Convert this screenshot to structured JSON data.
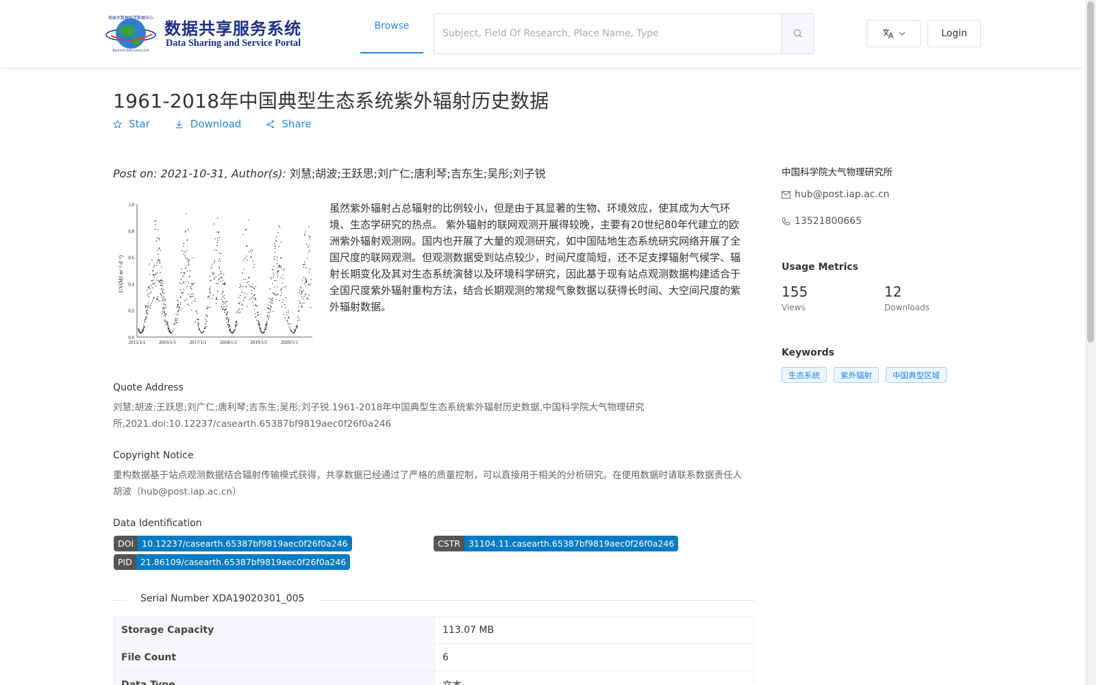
{
  "header": {
    "logo_cn": "数据共享服务系统",
    "logo_en": "Data Sharing and Service Portal",
    "nav_browse": "Browse",
    "search_placeholder": "Subject, Field Of Research, Place Name, Type",
    "login": "Login"
  },
  "dataset": {
    "title": "1961-2018年中国典型生态系统紫外辐射历史数据",
    "actions": {
      "star": "Star",
      "download": "Download",
      "share": "Share"
    },
    "post_prefix": "Post on: 2021-10-31, Author(s):",
    "authors": "刘慧;胡波;王跃思;刘广仁;唐利琴;吉东生;吴彤;刘子锐",
    "abstract": "虽然紫外辐射占总辐射的比例较小，但是由于其显著的生物、环境效应，使其成为大气环境、生态学研究的热点。 紫外辐射的联网观测开展得较晚，主要有20世纪80年代建立的欧洲紫外辐射观测网。国内也开展了大量的观测研究，如中国陆地生态系统研究网络开展了全国尺度的联网观测。但观测数据受到站点较少，时间尺度简短，还不足支撑辐射气候学、辐射长期变化及其对生态系统演替以及环境科学研究，因此基于现有站点观测数据构建适合于全国尺度紫外辐射重构方法，结合长期观测的常规气象数据以获得长时间、大空间尺度的紫外辐射数据。"
  },
  "figure": {
    "ylabel": "UV(MJ m⁻² d⁻¹)",
    "yticks": [
      "1.0",
      "0.8",
      "0.6",
      "0.4",
      "0.2",
      "0.0"
    ],
    "xticks": [
      "2015/1/1",
      "2016/1/1",
      "2017/1/1",
      "2018/1/1",
      "2019/1/1",
      "2020/1/1"
    ]
  },
  "quote": {
    "heading": "Quote Address",
    "text": "刘慧;胡波;王跃思;刘广仁;唐利琴;吉东生;吴彤;刘子锐.1961-2018年中国典型生态系统紫外辐射历史数据,中国科学院大气物理研究所,2021.doi:10.12237/casearth.65387bf9819aec0f26f0a246"
  },
  "copyright": {
    "heading": "Copyright Notice",
    "text": "重构数据基于站点观测数据结合辐射传输模式获得，共享数据已经通过了严格的质量控制，可以直接用于相关的分析研究。在使用数据时请联系数据责任人胡波（hub@post.iap.ac.cn）"
  },
  "identification": {
    "heading": "Data Identification",
    "doi_key": "DOI",
    "doi_val": "10.12237/casearth.65387bf9819aec0f26f0a246",
    "cstr_key": "CSTR",
    "cstr_val": "31104.11.casearth.65387bf9819aec0f26f0a246",
    "pid_key": "PID",
    "pid_val": "21.86109/casearth.65387bf9819aec0f26f0a246"
  },
  "serial": "Serial Number XDA19020301_005",
  "table": [
    {
      "key": "Storage Capacity",
      "value": "113.07 MB"
    },
    {
      "key": "File Count",
      "value": "6"
    },
    {
      "key": "Data Type",
      "value": "文本"
    }
  ],
  "sidebar": {
    "org": "中国科学院大气物理研究所",
    "email": "hub@post.iap.ac.cn",
    "phone": "13521800665",
    "usage_heading": "Usage Metrics",
    "views_num": "155",
    "views_label": "Views",
    "downloads_num": "12",
    "downloads_label": "Downloads",
    "keywords_heading": "Keywords",
    "keywords": [
      "生态系统",
      "紫外辐射",
      "中国典型区域"
    ]
  },
  "colors": {
    "accent": "#1f87e5",
    "badge_value": "#0a7bc1",
    "badge_key": "#555555"
  }
}
